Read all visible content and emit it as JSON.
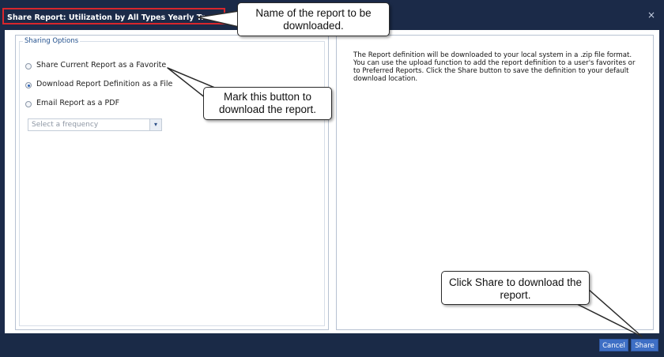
{
  "window": {
    "title": "Share Report: Utilization by All Types Yearly Trend",
    "close_glyph": "×"
  },
  "sharing_options": {
    "legend": "Sharing Options",
    "options": [
      {
        "label": "Share Current Report as a Favorite",
        "checked": false
      },
      {
        "label": "Download Report Definition as a File",
        "checked": true
      },
      {
        "label": "Email Report as a PDF",
        "checked": false
      }
    ],
    "frequency": {
      "placeholder": "Select a frequency",
      "arrow": "▾"
    }
  },
  "description": "The Report definition will be downloaded to your local system in a .zip file format. You can use the upload function to add the report definition to a user's favorites or to Preferred Reports. Click the Share button to save the definition to your default download location.",
  "buttons": {
    "cancel": "Cancel",
    "share": "Share"
  },
  "callouts": {
    "report_name": "Name of the report to be downloaded.",
    "mark_button": "Mark this button to download the report.",
    "click_share": "Click Share to download the report."
  },
  "colors": {
    "accent": "#3e6fc5",
    "frame": "#1b2a48",
    "highlight": "#d8262c"
  }
}
